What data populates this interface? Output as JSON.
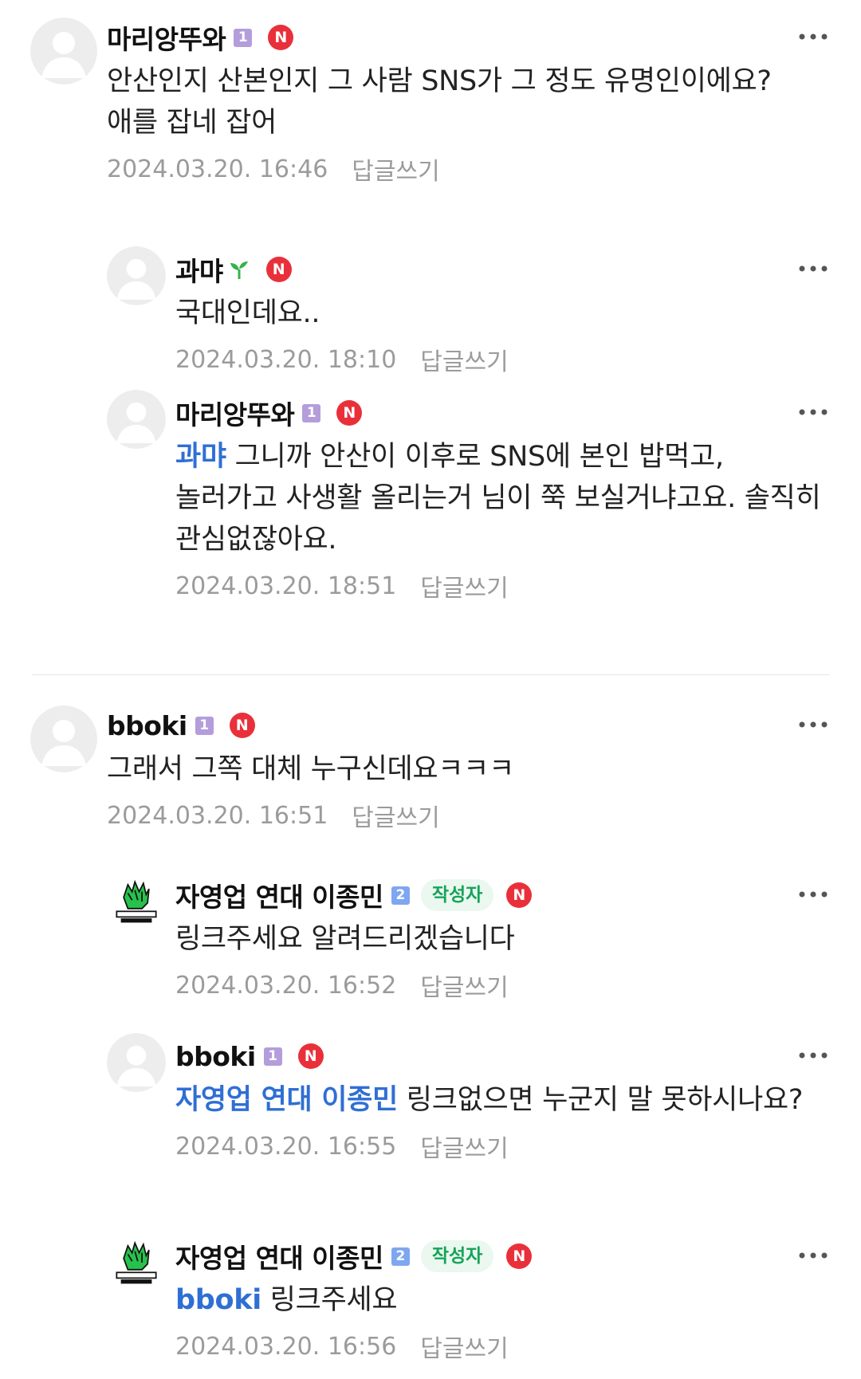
{
  "comments": [
    {
      "nick": "마리앙뚜와",
      "level": "1",
      "n_badge": "N",
      "text": "안산인지 산본인지 그 사람 SNS가 그 정도 유명인이에요?\n애를 잡네 잡어",
      "date": "2024.03.20. 16:46",
      "reply_label": "답글쓰기"
    },
    {
      "nick": "과먀",
      "n_badge": "N",
      "text": "국대인데요..",
      "date": "2024.03.20. 18:10",
      "reply_label": "답글쓰기"
    },
    {
      "nick": "마리앙뚜와",
      "level": "1",
      "n_badge": "N",
      "mention": "과먀",
      "text": " 그니까 안산이 이후로 SNS에 본인 밥먹고, 놀러가고 사생활 올리는거 님이 쭉 보실거냐고요. 솔직히 관심없잖아요.",
      "date": "2024.03.20. 18:51",
      "reply_label": "답글쓰기"
    },
    {
      "nick": "bboki",
      "level": "1",
      "n_badge": "N",
      "text": "그래서 그쪽 대체 누구신데요ㅋㅋㅋ",
      "date": "2024.03.20. 16:51",
      "reply_label": "답글쓰기"
    },
    {
      "nick": "자영업 연대 이종민",
      "level": "2",
      "author_badge": "작성자",
      "n_badge": "N",
      "text": "링크주세요 알려드리겠습니다",
      "date": "2024.03.20. 16:52",
      "reply_label": "답글쓰기"
    },
    {
      "nick": "bboki",
      "level": "1",
      "n_badge": "N",
      "mention": "자영업 연대 이종민",
      "text": " 링크없으면 누군지 말 못하시나요?",
      "date": "2024.03.20. 16:55",
      "reply_label": "답글쓰기"
    },
    {
      "nick": "자영업 연대 이종민",
      "level": "2",
      "author_badge": "작성자",
      "n_badge": "N",
      "mention": "bboki",
      "text": " 링크주세요",
      "date": "2024.03.20. 16:56",
      "reply_label": "답글쓰기"
    }
  ],
  "icons": {
    "more": "more-options-icon",
    "default_avatar": "default-profile-icon",
    "business_avatar": "fist-logo-avatar",
    "sprout": "sprout-icon"
  },
  "colors": {
    "mention": "#2f6fd4",
    "n_badge": "#e9303a",
    "author_badge_bg": "#eaf8ef",
    "author_badge_text": "#17a35a",
    "level1": "#b39ddb",
    "level2": "#7fa6f0"
  }
}
